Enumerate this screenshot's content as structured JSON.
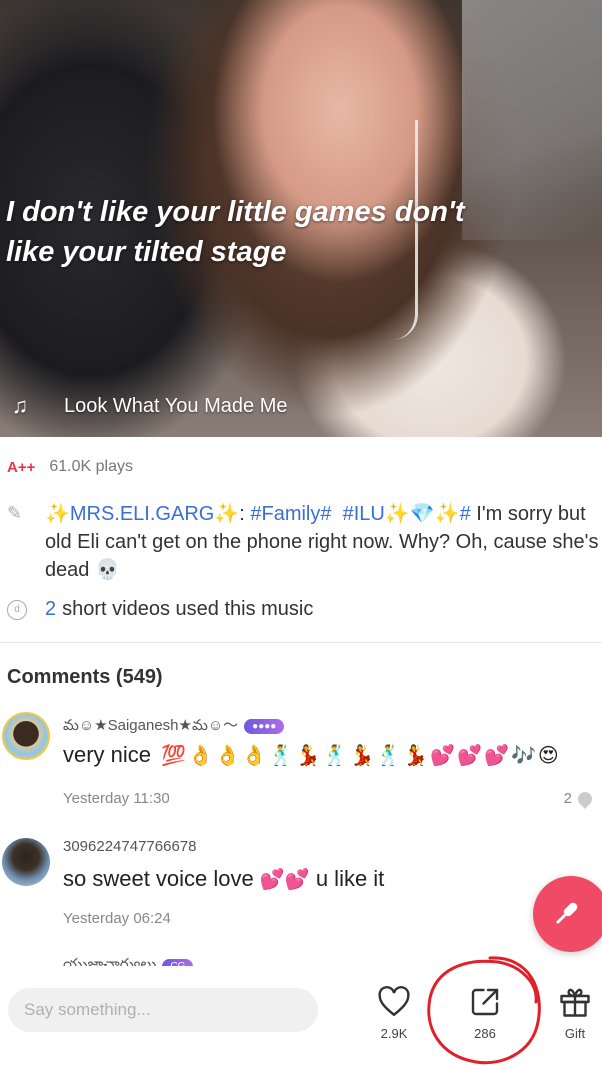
{
  "video": {
    "lyrics_line1": "I don't like your little games don't",
    "lyrics_line2": "like your tilted stage",
    "music_title": "Look What You Made Me"
  },
  "stats": {
    "grade": "A++",
    "plays": "61.0K plays"
  },
  "description": {
    "author": "MRS.ELI.GARG",
    "sep": ": ",
    "tag1": "#Family#",
    "tag2": "#ILU",
    "tag3": "#",
    "text": " I'm sorry but old Eli can't get on the phone right now.  Why?  Oh, cause she's dead"
  },
  "music_usage": {
    "count": "2",
    "text": "short videos used this music"
  },
  "comments": {
    "title": "Comments (549)",
    "items": [
      {
        "user": "మ☺★Saiganesh★మ☺〜",
        "badge": "●●●●",
        "text": "very nice",
        "time": "Yesterday 11:30",
        "likes": "2"
      },
      {
        "user": "3096224747766678",
        "text_before": "so sweet voice love",
        "text_after": "u like it",
        "time": "Yesterday 06:24"
      },
      {
        "user": "యుజ్ఞాచార్యులు",
        "badge": "CG"
      }
    ]
  },
  "bottom_bar": {
    "input_placeholder": "Say something...",
    "likes": "2.9K",
    "shares": "286",
    "gift_label": "Gift"
  },
  "colors": {
    "accent": "#ef4b66",
    "link": "#3a6fd8",
    "grade": "#e5344d",
    "annotation": "#e0202a"
  }
}
